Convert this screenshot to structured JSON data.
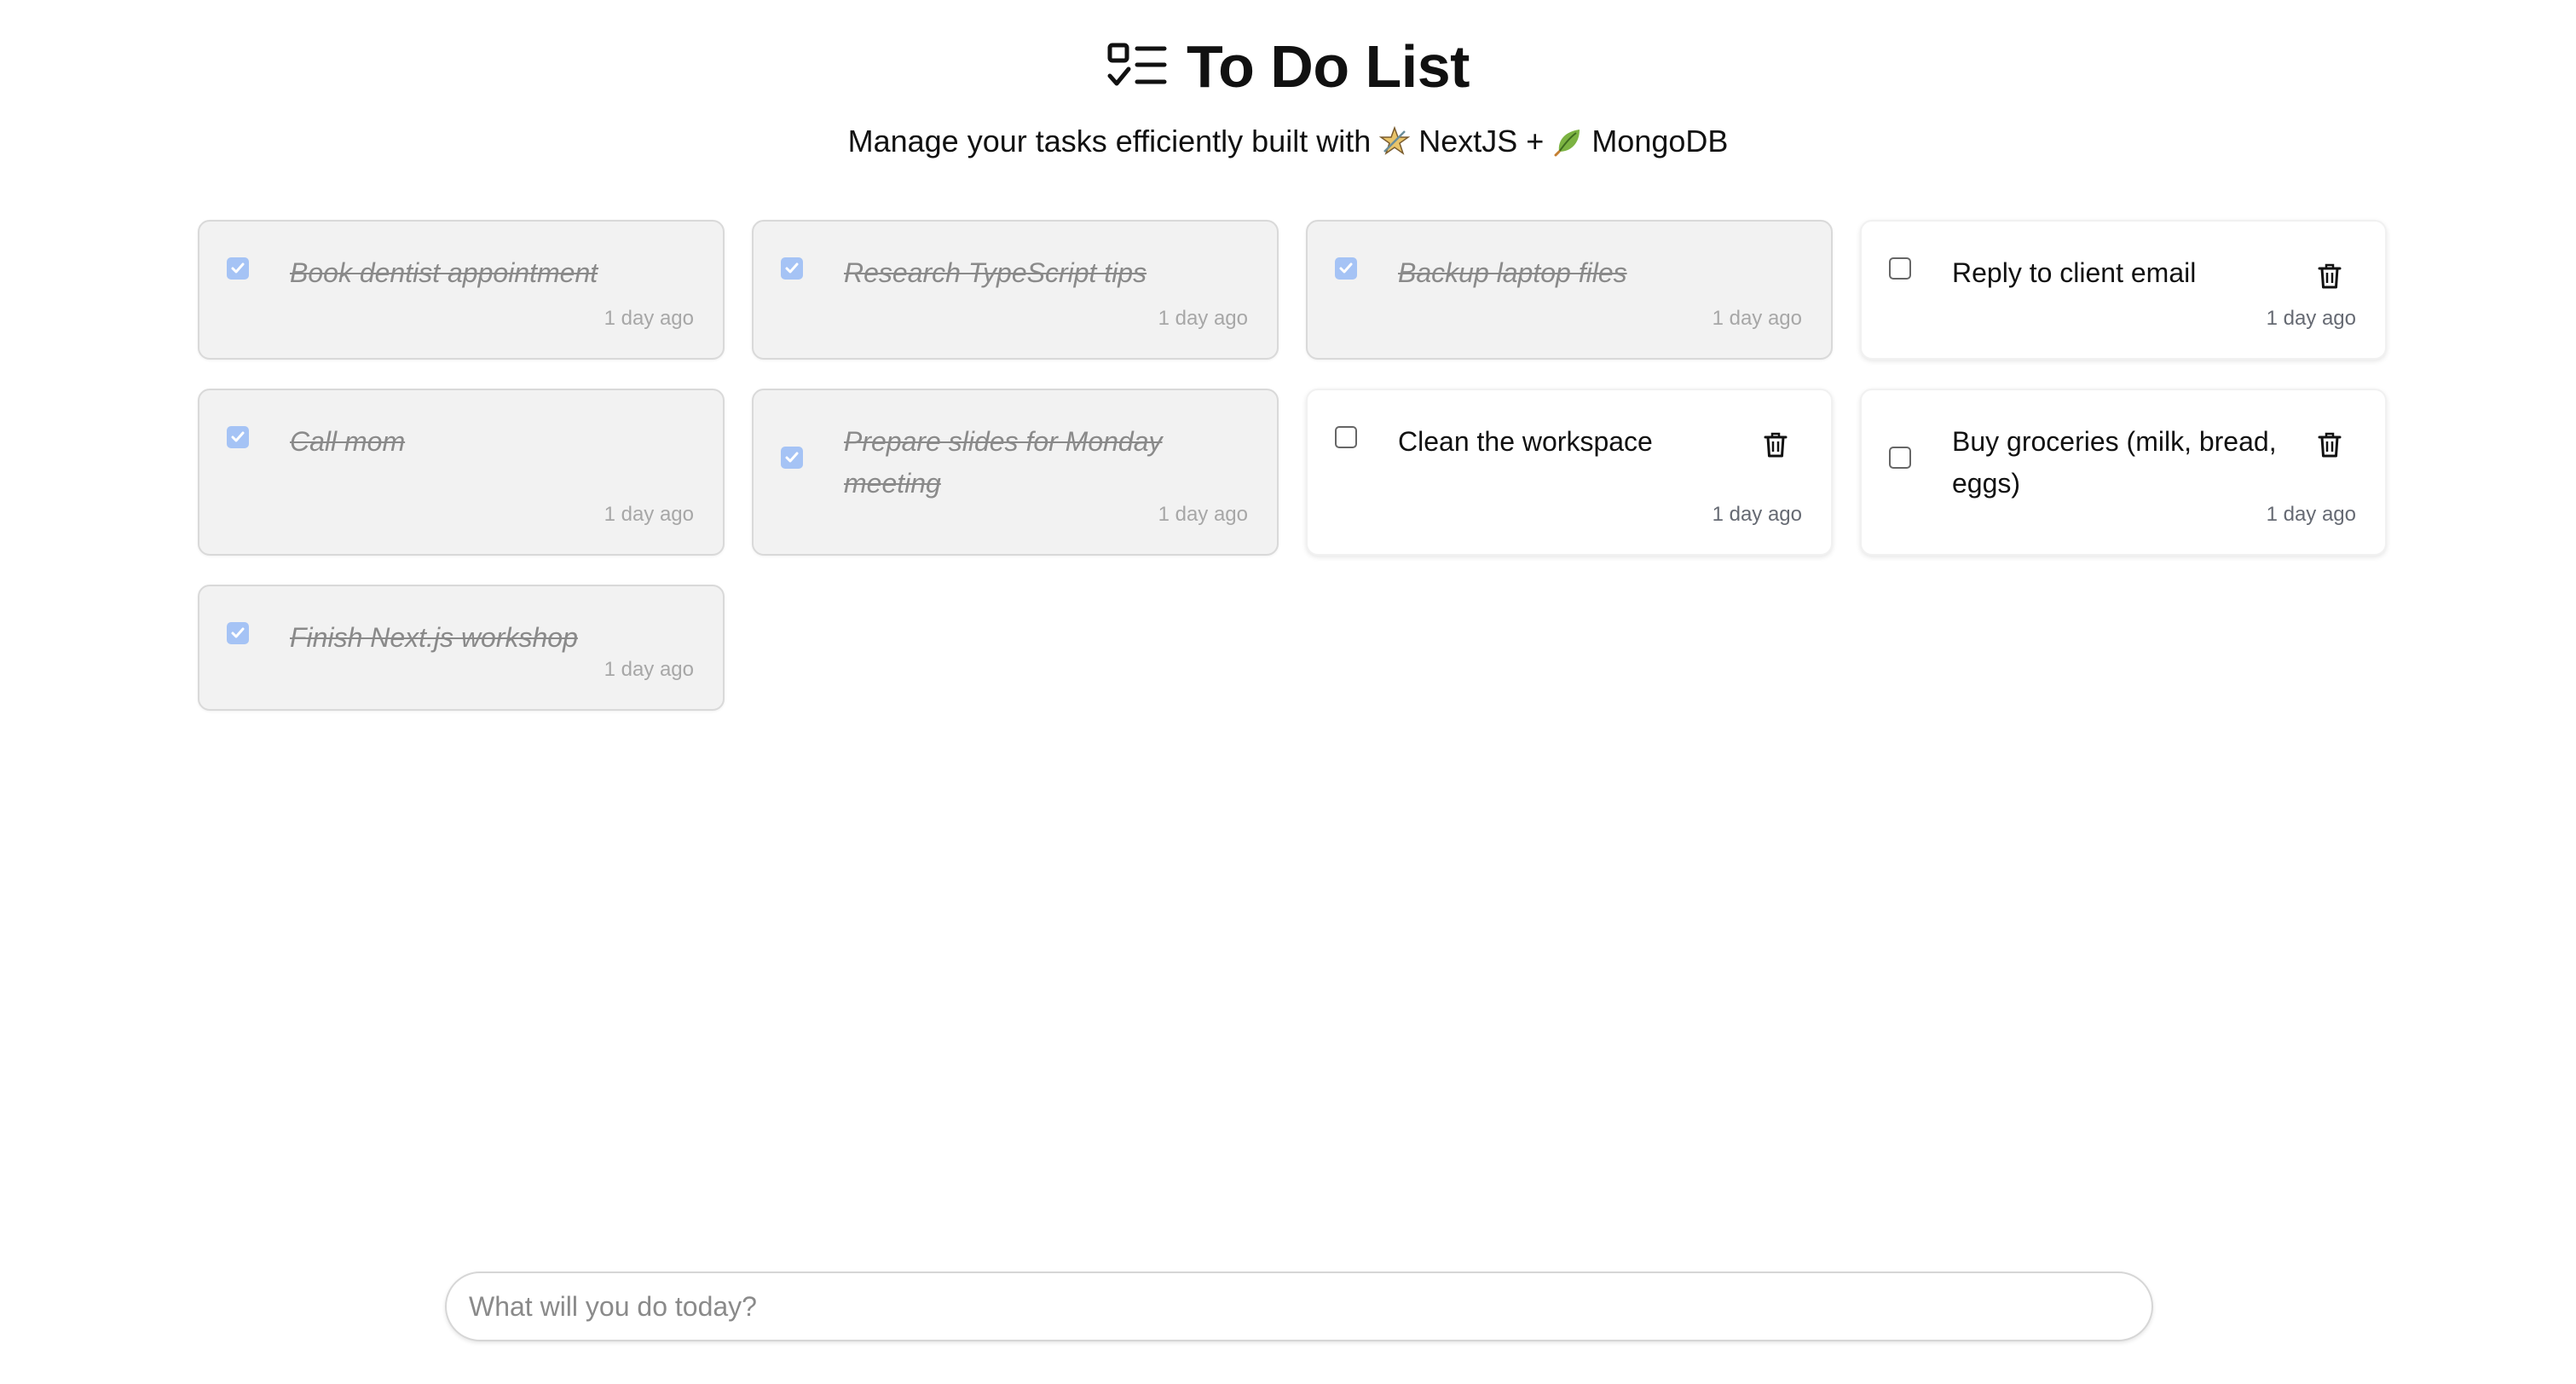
{
  "header": {
    "title": "To Do List",
    "title_icon": "list-checks-icon",
    "subtitle_prefix": "Manage your tasks efficiently built with",
    "tech_1": "NextJS",
    "plus": "+",
    "tech_2": "MongoDB",
    "tech_1_icon": "star-icon",
    "tech_2_icon": "leaf-icon"
  },
  "colors": {
    "checked_box": "#a5c3f5",
    "done_card_bg": "#f2f2f2",
    "done_text": "#8a8a8a"
  },
  "tasks": [
    {
      "text": "Book dentist appointment",
      "done": true,
      "time": "1 day ago"
    },
    {
      "text": "Research TypeScript tips",
      "done": true,
      "time": "1 day ago"
    },
    {
      "text": "Backup laptop files",
      "done": true,
      "time": "1 day ago"
    },
    {
      "text": "Reply to client email",
      "done": false,
      "time": "1 day ago"
    },
    {
      "text": "Call mom",
      "done": true,
      "time": "1 day ago"
    },
    {
      "text": "Prepare slides for Monday meeting",
      "done": true,
      "time": "1 day ago"
    },
    {
      "text": "Clean the workspace",
      "done": false,
      "time": "1 day ago"
    },
    {
      "text": "Buy groceries (milk, bread, eggs)",
      "done": false,
      "time": "1 day ago"
    },
    {
      "text": "Finish Next.js workshop",
      "done": true,
      "time": "1 day ago"
    }
  ],
  "new_task_input": {
    "value": "",
    "placeholder": "What will you do today?"
  }
}
